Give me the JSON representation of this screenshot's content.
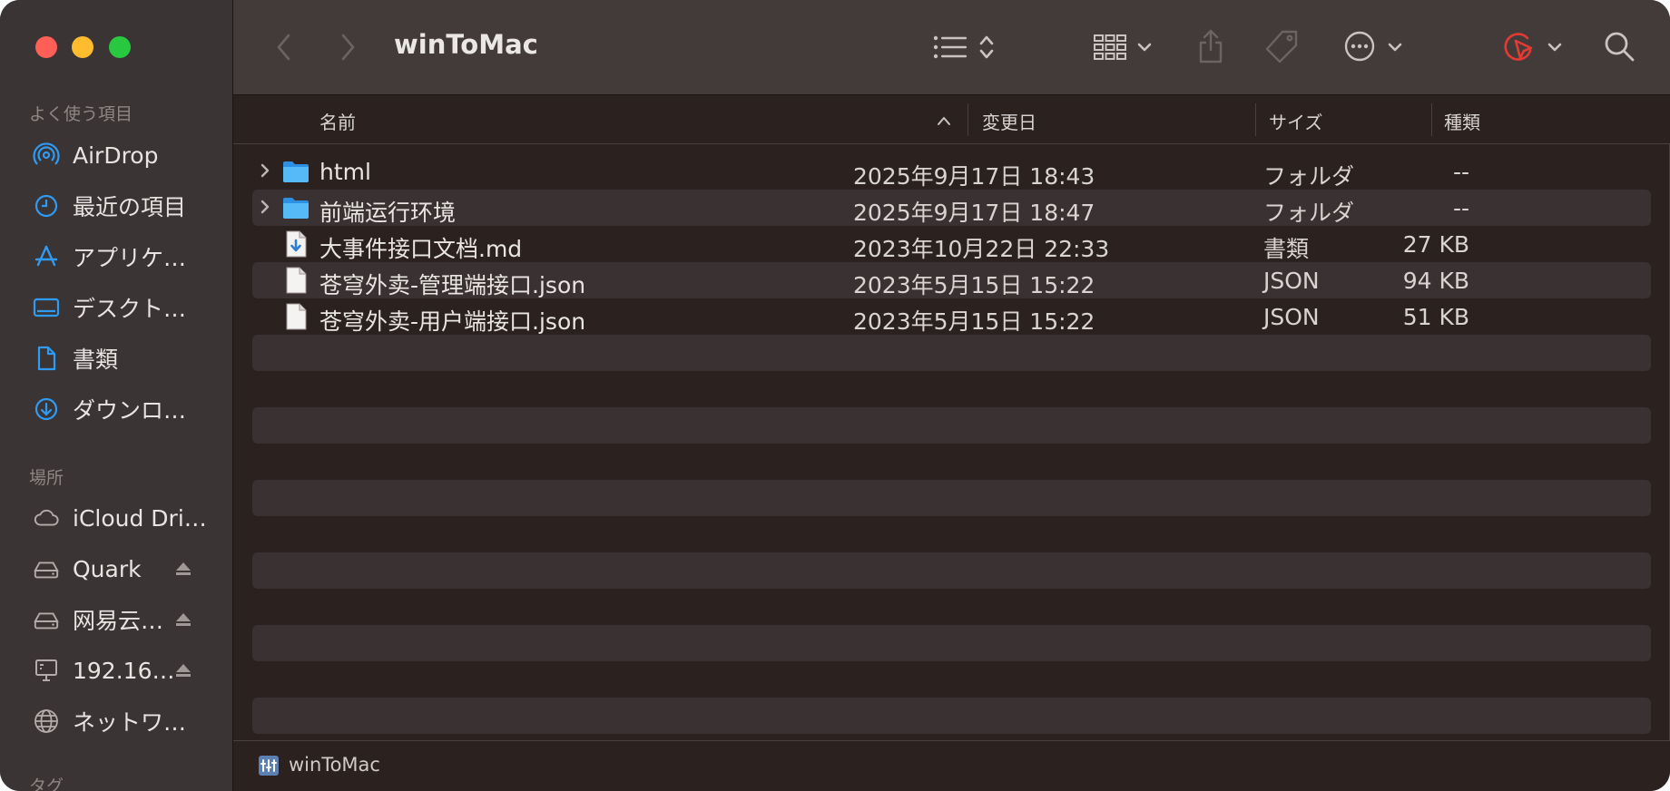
{
  "window": {
    "title": "winToMac"
  },
  "sidebar": {
    "favorites_heading": "よく使う項目",
    "favorites": [
      {
        "label": "AirDrop",
        "icon": "airdrop-icon"
      },
      {
        "label": "最近の項目",
        "icon": "clock-icon"
      },
      {
        "label": "アプリケ…",
        "icon": "applications-icon"
      },
      {
        "label": "デスクト…",
        "icon": "desktop-icon"
      },
      {
        "label": "書類",
        "icon": "document-icon"
      },
      {
        "label": "ダウンロ…",
        "icon": "download-icon"
      }
    ],
    "locations_heading": "場所",
    "locations": [
      {
        "label": "iCloud Dri…",
        "icon": "cloud-icon"
      },
      {
        "label": "Quark",
        "icon": "drive-icon",
        "eject": true
      },
      {
        "label": "网易云…",
        "icon": "drive-icon",
        "eject": true
      },
      {
        "label": "192.16…",
        "icon": "server-icon",
        "eject": true
      },
      {
        "label": "ネットワ…",
        "icon": "globe-icon"
      }
    ],
    "tags_heading": "タグ"
  },
  "columns": {
    "name": "名前",
    "date": "変更日",
    "size": "サイズ",
    "kind": "種類"
  },
  "files": [
    {
      "name": "html",
      "date": "2025年9月17日 18:43",
      "size": "--",
      "kind": "フォルダ",
      "type": "folder"
    },
    {
      "name": "前端运行环境",
      "date": "2025年9月17日 18:47",
      "size": "--",
      "kind": "フォルダ",
      "type": "folder"
    },
    {
      "name": "大事件接口文档.md",
      "date": "2023年10月22日 22:33",
      "size": "27 KB",
      "kind": "書類",
      "type": "md"
    },
    {
      "name": "苍穹外卖-管理端接口.json",
      "date": "2023年5月15日 15:22",
      "size": "94 KB",
      "kind": "JSON",
      "type": "json"
    },
    {
      "name": "苍穹外卖-用户端接口.json",
      "date": "2023年5月15日 15:22",
      "size": "51 KB",
      "kind": "JSON",
      "type": "json"
    }
  ],
  "pathbar": {
    "label": "winToMac"
  },
  "colors": {
    "accent": "#2f9bf5",
    "folder": "#3fa9f5",
    "close": "#ff5f57",
    "minimize": "#febc2e",
    "zoom": "#28c840",
    "toolbar_bg": "#423b3a",
    "sidebar_bg": "#3a3434",
    "list_bg": "#2b2220",
    "stripe": "#3a3232"
  }
}
